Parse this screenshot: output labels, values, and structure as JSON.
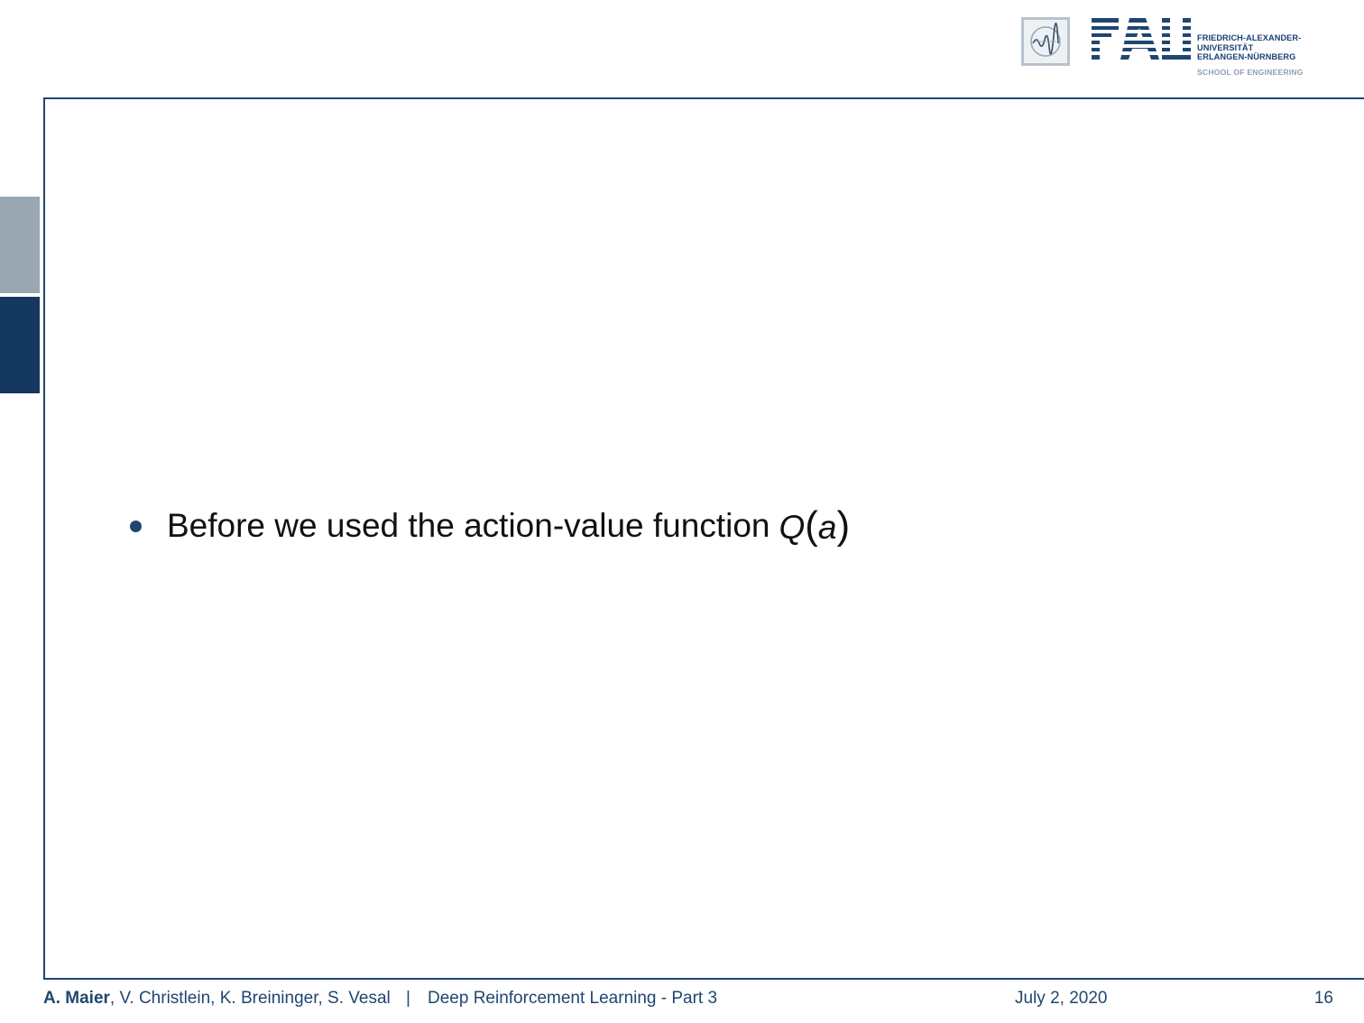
{
  "header": {
    "university_line1": "FRIEDRICH-ALEXANDER-",
    "university_line2": "UNIVERSITÄT",
    "university_line3": "ERLANGEN-NÜRNBERG",
    "school": "SCHOOL OF ENGINEERING",
    "logo_text": "FAU",
    "brand_color": "#1f4670"
  },
  "slide": {
    "bullet_text": "Before we used the action-value function",
    "math_symbol": "Q",
    "math_arg": "a",
    "math_open": "(",
    "math_close": ")"
  },
  "footer": {
    "lead_author": "A. Maier",
    "other_authors": ", V. Christlein, K. Breininger, S. Vesal",
    "separator": "|",
    "talk_title": "Deep Reinforcement Learning - Part 3",
    "date": "July 2, 2020",
    "page_number": "16"
  }
}
